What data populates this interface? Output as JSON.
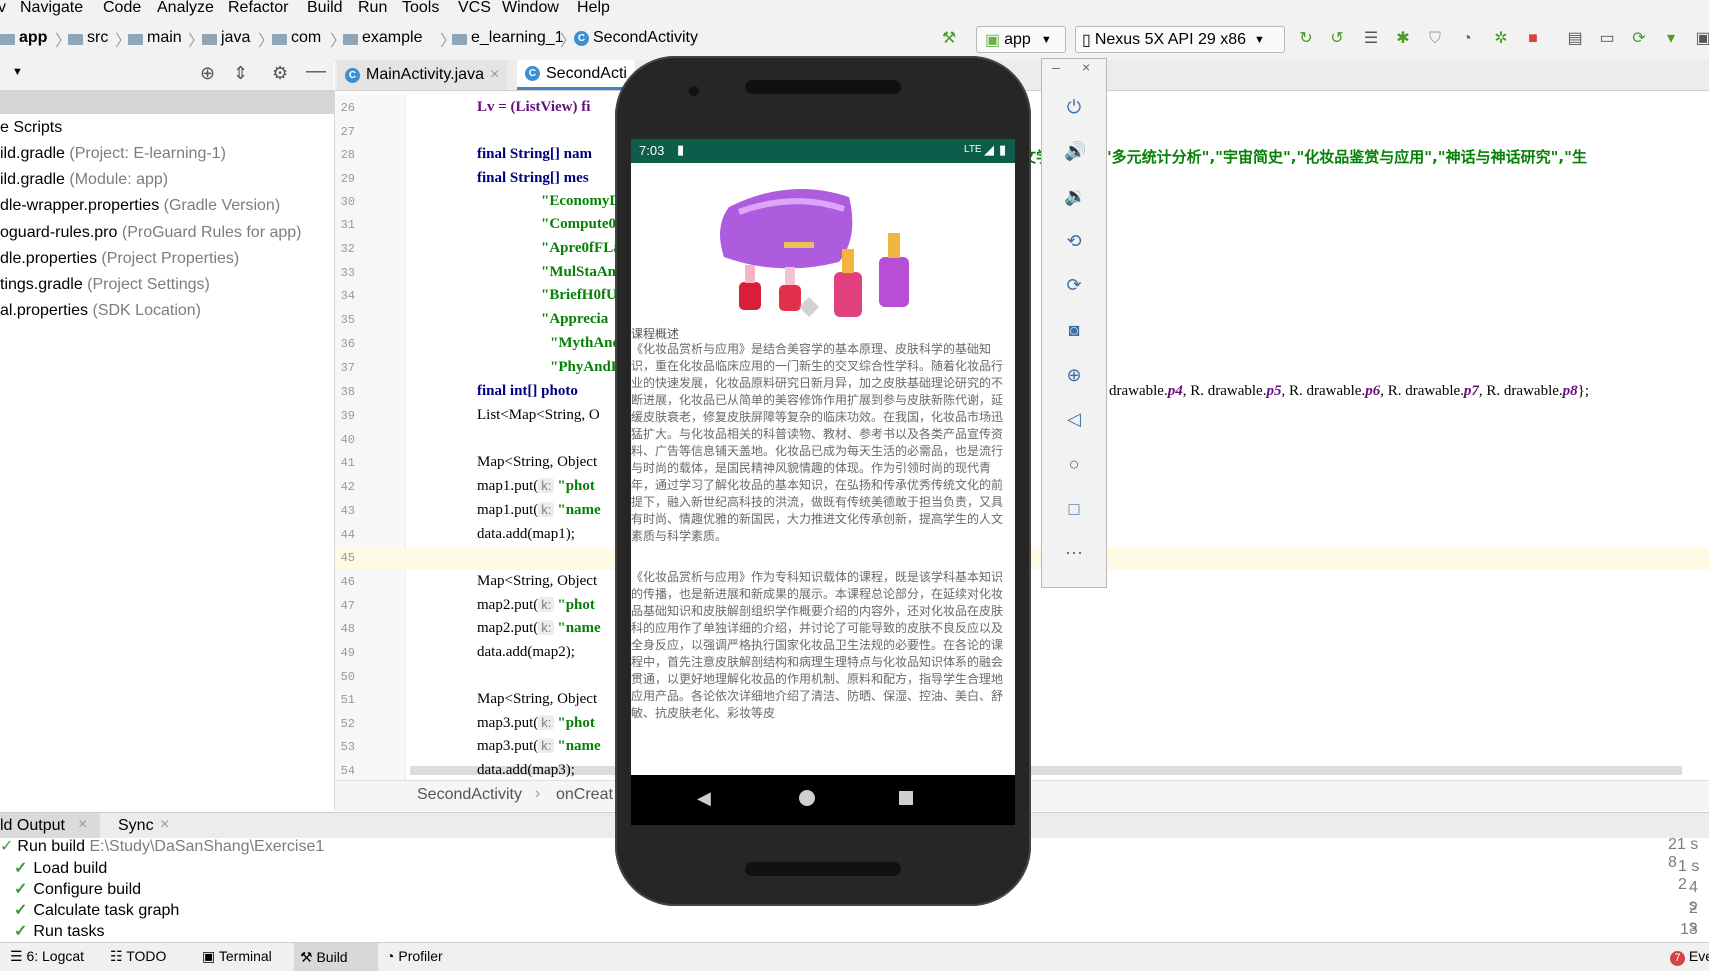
{
  "menu": [
    "v",
    "Navigate",
    "Code",
    "Analyze",
    "Refactor",
    "Build",
    "Run",
    "Tools",
    "VCS",
    "Window",
    "Help"
  ],
  "breadcrumbs": [
    "app",
    "src",
    "main",
    "java",
    "com",
    "example",
    "e_learning_1",
    "SecondActivity"
  ],
  "run_config": "app",
  "device": "Nexus 5X API 29 x86",
  "project_items": [
    {
      "name": "e Scripts",
      "hint": ""
    },
    {
      "name": "ild.gradle",
      "hint": "(Project: E-learning-1)"
    },
    {
      "name": "ild.gradle",
      "hint": "(Module: app)"
    },
    {
      "name": "dle-wrapper.properties",
      "hint": "(Gradle Version)"
    },
    {
      "name": "oguard-rules.pro",
      "hint": "(ProGuard Rules for app)"
    },
    {
      "name": "dle.properties",
      "hint": "(Project Properties)"
    },
    {
      "name": "tings.gradle",
      "hint": "(Project Settings)"
    },
    {
      "name": "al.properties",
      "hint": "(SDK Location)"
    }
  ],
  "tabs": {
    "main": "MainActivity.java",
    "second": "SecondActi"
  },
  "code": {
    "line_numbers": [
      "26",
      "27",
      "28",
      "29",
      "30",
      "31",
      "32",
      "33",
      "34",
      "35",
      "36",
      "37",
      "38",
      "39",
      "40",
      "41",
      "42",
      "43",
      "44",
      "45",
      "46",
      "47",
      "48",
      "49",
      "50",
      "51",
      "52",
      "53",
      "54"
    ],
    "l26": "Lv = (ListView) fi",
    "l28a": "final String[] nam",
    "l28b": "文学欣赏\"，\"多元统计分析\",\"宇宙简史\",\"化妆品鉴赏与应用\",\"神话与神话研究\",\"生",
    "l29": "final String[] mes",
    "l30": "\"EconomyDe",
    "l31": "\"Compute0S",
    "l32": "\"Apre0fFLa",
    "l33": "\"MulStaAna",
    "l34": "\"BriefH0fU",
    "l35": "\"Apprecia",
    "l36": "\"MythAndM",
    "l37": "\"PhyAndPs",
    "l38a": "final int[] photo",
    "l38b": "drawable.",
    "l38b_f": "p4",
    "l38c": ", R. drawable.",
    "l38c_f": "p5",
    "l38d": ", R. drawable.",
    "l38d_f": "p6",
    "l38e": ", R. drawable.",
    "l38e_f": "p7",
    "l38f": ", R. drawable.",
    "l38f_f": "p8",
    "l38g": "};",
    "l39": "List<Map<String, O",
    "l41": "Map<String, Object",
    "l42": "map1.put(",
    "l42s": "\"phot",
    "l43": "map1.put(",
    "l43s": "\"name",
    "l44": "data.add(map1);",
    "l46": "Map<String, Object",
    "l47": "map2.put(",
    "l47s": "\"phot",
    "l48": "map2.put(",
    "l48s": "\"name",
    "l49": "data.add(map2);",
    "l51": "Map<String, Object",
    "l52": "map3.put(",
    "l52s": "\"phot",
    "l53": "map3.put(",
    "l53s": "\"name",
    "l54": "data.add(map3);",
    "hint_k": "k:"
  },
  "editor_breadcrumb": [
    "SecondActivity",
    "onCreat"
  ],
  "build_tabs": [
    "ld Output",
    "Sync"
  ],
  "build_rows": [
    {
      "label": "Run build",
      "detail": "E:\\Study\\DaSanShang\\Exercise1",
      "time": "21 s 8"
    },
    {
      "label": "Load build",
      "detail": "",
      "time": "1 s 2"
    },
    {
      "label": "Configure build",
      "detail": "",
      "time": "4 s"
    },
    {
      "label": "Calculate task graph",
      "detail": "",
      "time": "2 s"
    },
    {
      "label": "Run tasks",
      "detail": "",
      "time": "13 s"
    }
  ],
  "bottom_tabs": [
    "6: Logcat",
    "TODO",
    "Terminal",
    "Build",
    "Profiler"
  ],
  "event_log": {
    "count": "7",
    "label": "Eve"
  },
  "phone": {
    "time": "7:03",
    "network": "LTE",
    "section_title": "课程概述",
    "para1": "《化妆品赏析与应用》是结合美容学的基本原理、皮肤科学的基础知识，重在化妆品临床应用的一门新生的交叉综合性学科。随着化妆品行业的快速发展，化妆品原料研究日新月异，加之皮肤基础理论研究的不断进展，化妆品已从简单的美容修饰作用扩展到参与皮肤新陈代谢，延缓皮肤衰老，修复皮肤屏障等复杂的临床功效。在我国，化妆品市场迅猛扩大。与化妆品相关的科普读物、教材、参考书以及各类产品宣传资料、广告等信息铺天盖地。化妆品已成为每天生活的必需品，也是流行与时尚的载体，是国民精神风貌情趣的体现。作为引领时尚的现代青年，通过学习了解化妆品的基本知识，在弘扬和传承优秀传统文化的前提下，融入新世纪高科技的洪流，做既有传统美德敢于担当负责，又具有时尚、情趣优雅的新国民，大力推进文化传承创新，提高学生的人文素质与科学素质。",
    "para2": "《化妆品赏析与应用》作为专科知识载体的课程，既是该学科基本知识的传播，也是新进展和新成果的展示。本课程总论部分，在延续对化妆品基础知识和皮肤解剖组织学作概要介绍的内容外，还对化妆品在皮肤科的应用作了单独详细的介绍，并讨论了可能导致的皮肤不良反应以及全身反应，以强调严格执行国家化妆品卫生法规的必要性。在各论的课程中，首先注意皮肤解剖结构和病理生理特点与化妆品知识体系的融会贯通，以更好地理解化妆品的作用机制、原料和配方，指导学生合理地应用产品。各论依次详细地介绍了清洁、防晒、保湿、控油、美白、舒敏、抗皮肤老化、彩妆等皮"
  }
}
